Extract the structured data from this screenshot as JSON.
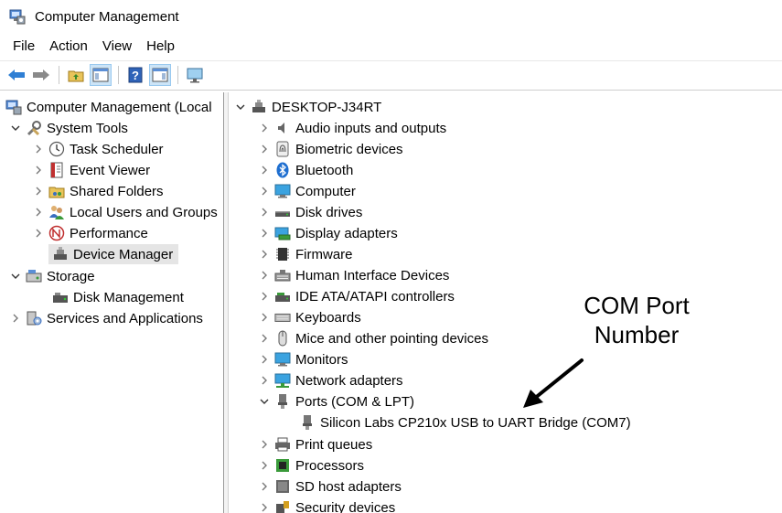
{
  "window": {
    "title": "Computer Management"
  },
  "menu": {
    "file": "File",
    "action": "Action",
    "view": "View",
    "help": "Help"
  },
  "left_tree": {
    "root": "Computer Management (Local",
    "system_tools": "System Tools",
    "task_scheduler": "Task Scheduler",
    "event_viewer": "Event Viewer",
    "shared_folders": "Shared Folders",
    "local_users": "Local Users and Groups",
    "performance": "Performance",
    "device_manager": "Device Manager",
    "storage": "Storage",
    "disk_management": "Disk Management",
    "services": "Services and Applications"
  },
  "device_tree": {
    "root": "DESKTOP-J34RT",
    "audio": "Audio inputs and outputs",
    "biometric": "Biometric devices",
    "bluetooth": "Bluetooth",
    "computer": "Computer",
    "disk_drives": "Disk drives",
    "display": "Display adapters",
    "firmware": "Firmware",
    "hid": "Human Interface Devices",
    "ide": "IDE ATA/ATAPI controllers",
    "keyboards": "Keyboards",
    "mice": "Mice and other pointing devices",
    "monitors": "Monitors",
    "network": "Network adapters",
    "ports": "Ports (COM & LPT)",
    "ports_child": "Silicon Labs CP210x USB to UART Bridge (COM7)",
    "print_queues": "Print queues",
    "processors": "Processors",
    "sd_host": "SD host adapters",
    "security": "Security devices"
  },
  "annotation": {
    "line1": "COM Port",
    "line2": "Number"
  }
}
